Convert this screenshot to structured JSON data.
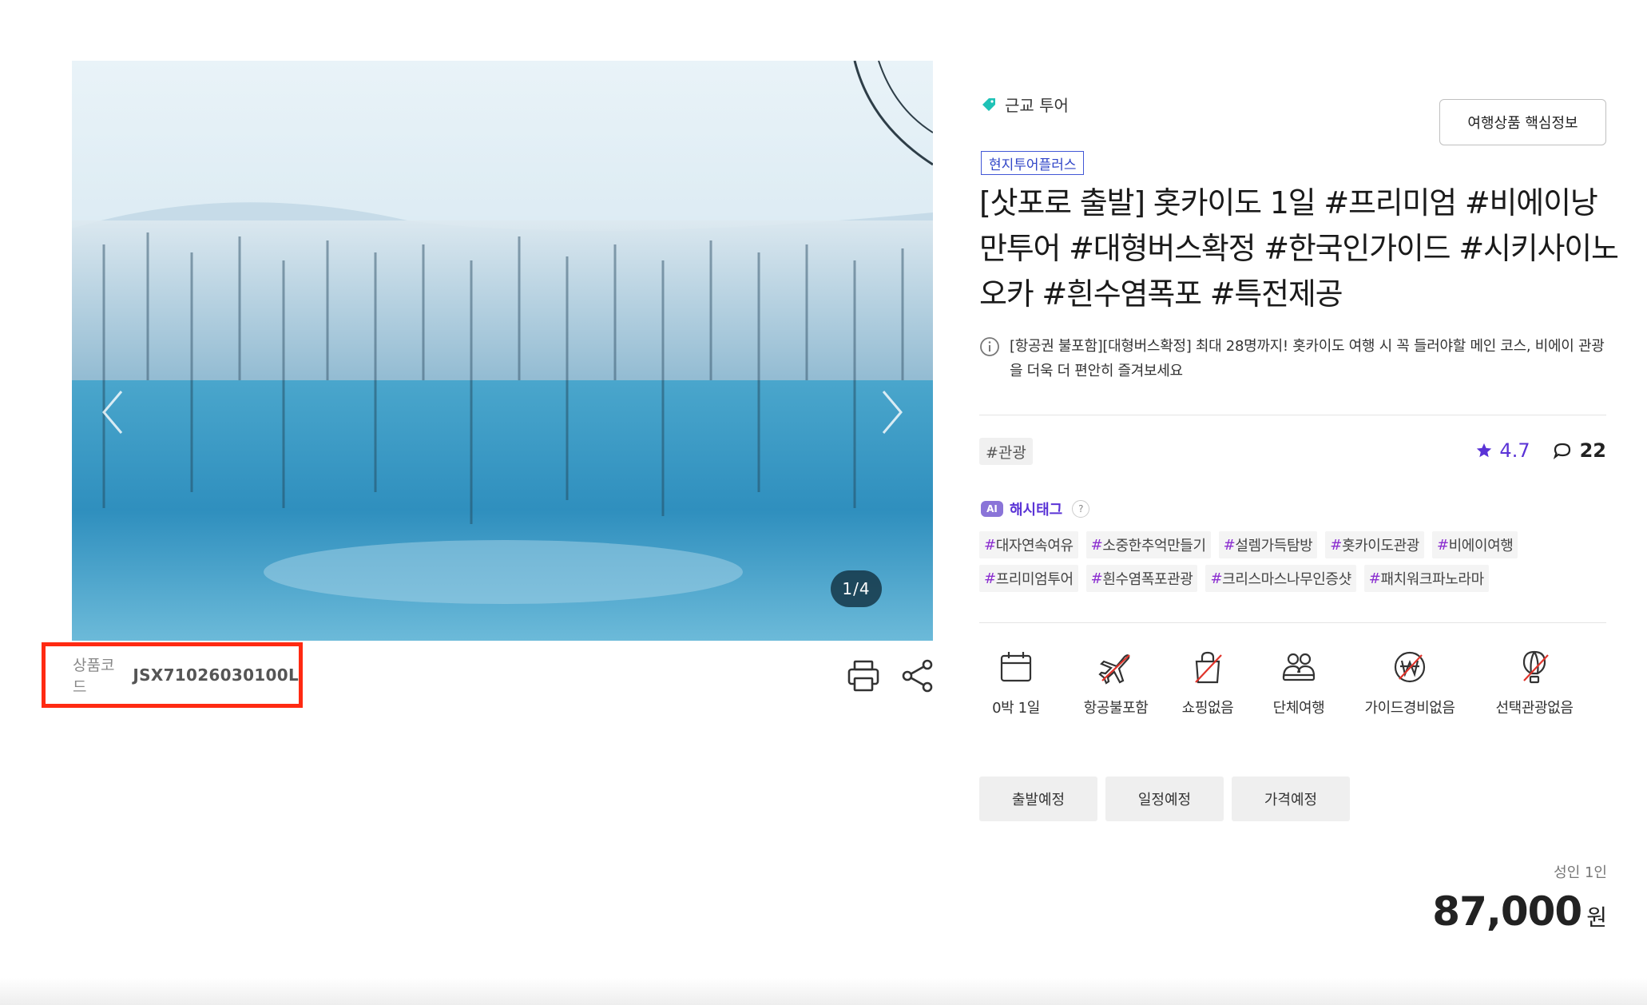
{
  "gallery": {
    "counter": "1/4",
    "prev_icon": "chevron-left-icon",
    "next_icon": "chevron-right-icon"
  },
  "product_code": {
    "label": "상품코드",
    "value": "JSX71026030100L",
    "highlight_color": "#ff2a12"
  },
  "tools": {
    "print_icon": "printer-icon",
    "share_icon": "share-icon"
  },
  "header": {
    "category": "근교 투어",
    "category_icon": "tag-icon",
    "key_info_button": "여행상품 핵심정보",
    "badge": "현지투어플러스",
    "title": "[삿포로 출발] 홋카이도 1일 #프리미엄 #비에이낭만투어 #대형버스확정 #한국인가이드 #시키사이노오카 #흰수염폭포 #특전제공"
  },
  "notice": {
    "icon": "info-icon",
    "text": "[항공권 불포함][대형버스확정] 최대 28명까지! 홋카이도 여행 시 꼭 들러야할 메인 코스, 비에이 관광을 더욱 더 편안히 즐겨보세요"
  },
  "theme_tag": "#관광",
  "rating": {
    "score": "4.7",
    "reviews": "22",
    "star_color": "#5a33d6"
  },
  "ai_hashtags": {
    "chip": "AI",
    "label": "해시태그",
    "help": "?",
    "rows": [
      [
        "대자연속여유",
        "소중한추억만들기",
        "설렘가득탐방",
        "홋카이도관광",
        "비에이여행"
      ],
      [
        "프리미엄투어",
        "흰수염폭포관광",
        "크리스마스나무인증샷",
        "패치워크파노라마"
      ]
    ]
  },
  "features": [
    {
      "icon": "calendar-icon",
      "label": "0박 1일"
    },
    {
      "icon": "no-flight-icon",
      "label": "항공불포함"
    },
    {
      "icon": "no-shopping-icon",
      "label": "쇼핑없음"
    },
    {
      "icon": "group-icon",
      "label": "단체여행"
    },
    {
      "icon": "won-icon",
      "label": "가이드경비없음"
    },
    {
      "icon": "no-balloon-icon",
      "label": "선택관광없음"
    }
  ],
  "status_buttons": [
    "출발예정",
    "일정예정",
    "가격예정"
  ],
  "price": {
    "unit": "성인 1인",
    "amount": "87,000",
    "currency": "원"
  }
}
